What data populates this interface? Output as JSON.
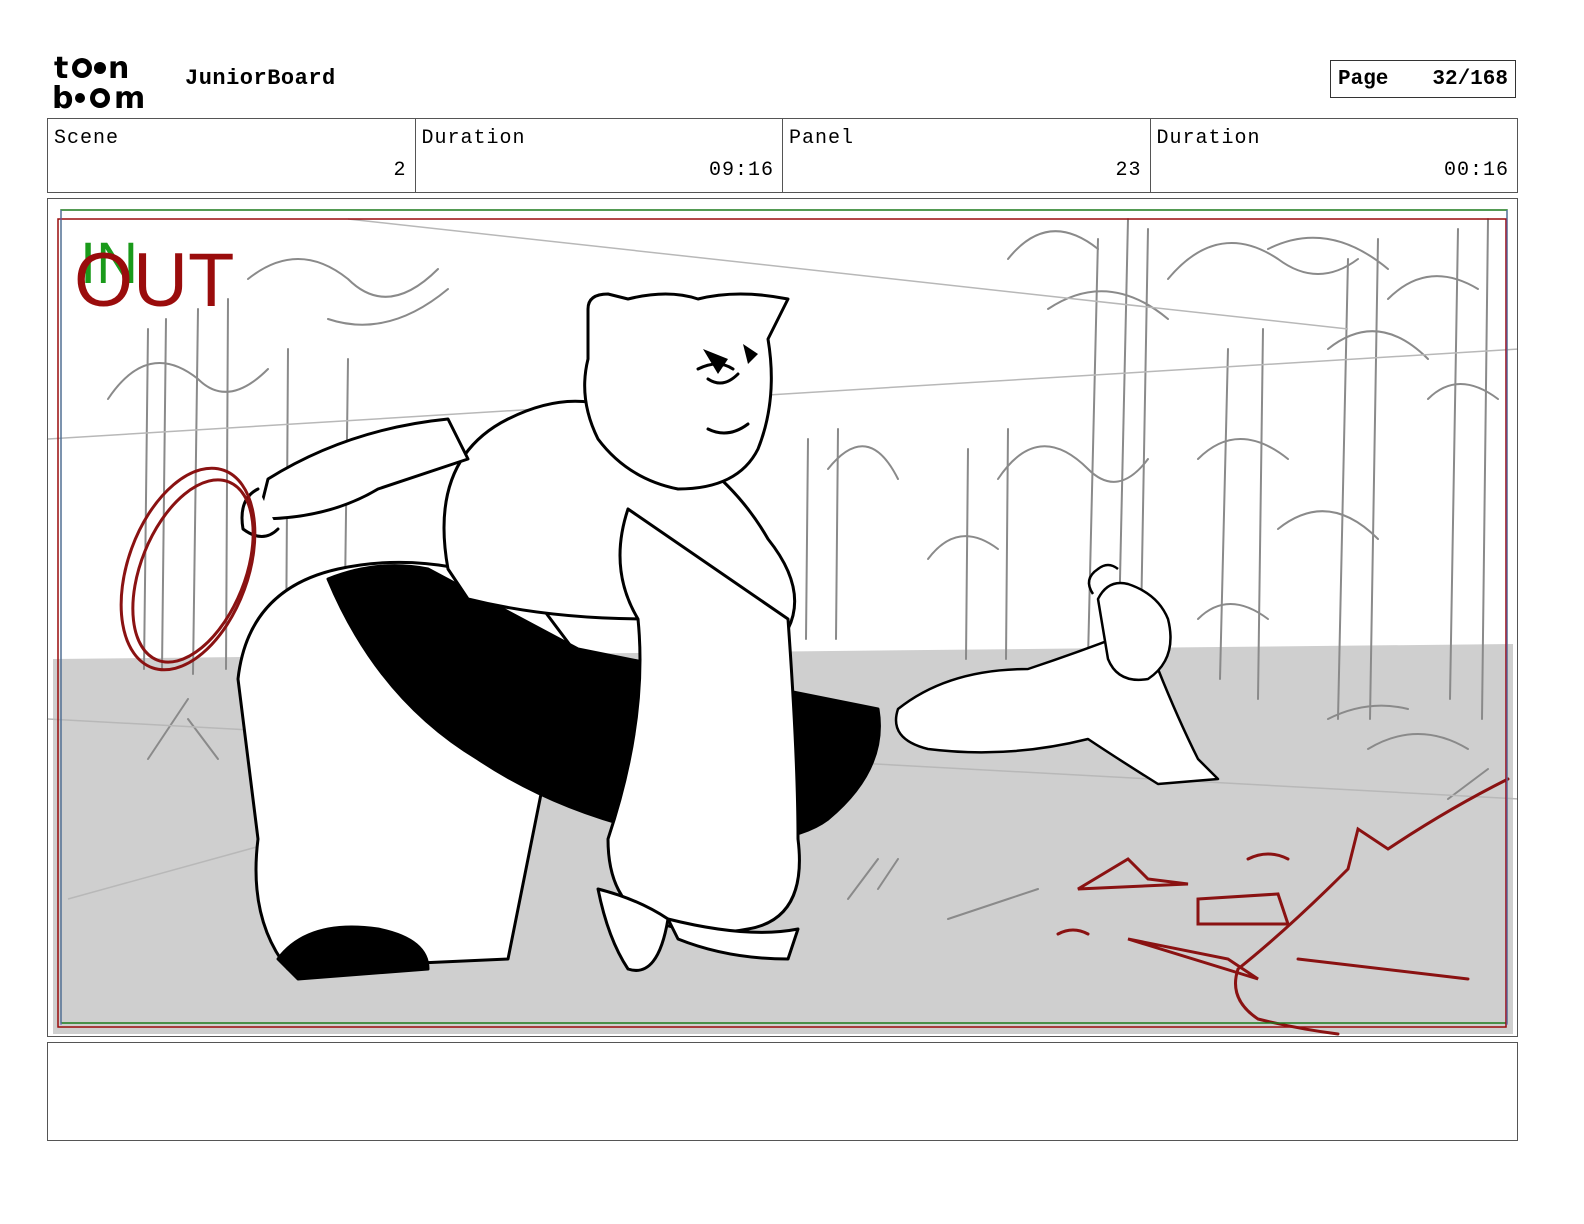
{
  "header": {
    "logo_text": "toon boom",
    "app_name": "JuniorBoard",
    "page_label": "Page",
    "page_value": "32/168"
  },
  "info": {
    "scene_label": "Scene",
    "scene_value": "2",
    "duration_label": "Duration",
    "duration_value": "09:16",
    "panel_label": "Panel",
    "panel_value": "23",
    "panel_duration_label": "Duration",
    "panel_duration_value": "00:16"
  },
  "panel": {
    "in_label": "IN",
    "out_label": "OUT",
    "in_color": "#1a9a1a",
    "out_color": "#9a0c0c",
    "description": ""
  },
  "notes": {
    "text": ""
  }
}
